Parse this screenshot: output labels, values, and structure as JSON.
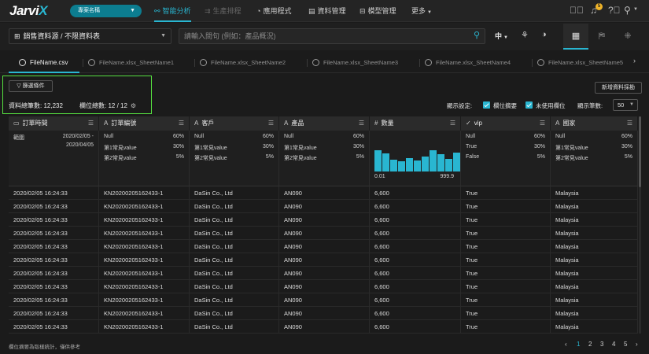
{
  "app": {
    "logo_main": "Jarvi",
    "logo_accent": "X",
    "project": "專案名稱",
    "nav": [
      {
        "label": "智能分析",
        "icon": "analysis-icon",
        "state": "active"
      },
      {
        "label": "生產排程",
        "icon": "schedule-icon",
        "state": "disabled"
      },
      {
        "label": "應用程式",
        "icon": "apps-icon",
        "state": "normal"
      },
      {
        "label": "資料管理",
        "icon": "data-icon",
        "state": "normal"
      },
      {
        "label": "模型管理",
        "icon": "model-icon",
        "state": "normal"
      },
      {
        "label": "更多",
        "icon": "chevron-down-icon",
        "state": "normal"
      }
    ],
    "notification_count": "5"
  },
  "toolbar": {
    "datasource": "銷售資料源 / 不限資料表",
    "query_placeholder": "請輸入問句 (例如：產品概況)",
    "language": "中"
  },
  "file_tabs": [
    {
      "label": "FileName.csv",
      "active": true
    },
    {
      "label": "FileName.xlsx_SheetName1",
      "active": false
    },
    {
      "label": "FileName.xlsx_SheetName2",
      "active": false
    },
    {
      "label": "FileName.xlsx_SheetName3",
      "active": false
    },
    {
      "label": "FileName.xlsx_SheetName4",
      "active": false
    },
    {
      "label": "FileName.xlsx_SheetName5",
      "active": false
    }
  ],
  "controls": {
    "filter_label": "篩選條件",
    "total_records": "資料總筆數: 12,232",
    "total_columns": "欄位總數: 12 / 12",
    "new_mapping": "新增資料採勘",
    "display_settings": "顯示設定:",
    "show_summary": "欄位摘要",
    "show_unused": "未使用欄位",
    "page_size_label": "顯示筆數:",
    "page_size": "50"
  },
  "columns": [
    {
      "type_icon": "▭",
      "name": "訂單時間"
    },
    {
      "type_icon": "A",
      "name": "訂單編號"
    },
    {
      "type_icon": "A",
      "name": "客戶"
    },
    {
      "type_icon": "A",
      "name": "產品"
    },
    {
      "type_icon": "#",
      "name": "數量"
    },
    {
      "type_icon": "✓",
      "name": "vip"
    },
    {
      "type_icon": "A",
      "name": "國家"
    }
  ],
  "summary": {
    "date_label": "範圍",
    "date_from": "2020/02/05 -",
    "date_to": "2020/04/05",
    "text_stats": [
      {
        "label": "Null",
        "pct": "60%"
      },
      {
        "label": "第1常見value",
        "pct": "30%"
      },
      {
        "label": "第2常見value",
        "pct": "5%"
      }
    ],
    "bool_stats": [
      {
        "label": "Null",
        "pct": "60%"
      },
      {
        "label": "True",
        "pct": "30%"
      },
      {
        "label": "False",
        "pct": "5%"
      }
    ],
    "histogram": {
      "min": "0.01",
      "max": "999.9",
      "bins": [
        0.95,
        0.82,
        0.55,
        0.45,
        0.6,
        0.5,
        0.68,
        0.95,
        0.78,
        0.58,
        0.85
      ]
    }
  },
  "rows": [
    [
      "2020/02/05 16:24:33",
      "KN20200205162433-1",
      "DaSin Co., Ltd",
      "AN090",
      "6,600",
      "True",
      "Malaysia"
    ],
    [
      "2020/02/05 16:24:33",
      "KN20200205162433-1",
      "DaSin Co., Ltd",
      "AN090",
      "6,600",
      "True",
      "Malaysia"
    ],
    [
      "2020/02/05 16:24:33",
      "KN20200205162433-1",
      "DaSin Co., Ltd",
      "AN090",
      "6,600",
      "True",
      "Malaysia"
    ],
    [
      "2020/02/05 16:24:33",
      "KN20200205162433-1",
      "DaSin Co., Ltd",
      "AN090",
      "6,600",
      "True",
      "Malaysia"
    ],
    [
      "2020/02/05 16:24:33",
      "KN20200205162433-1",
      "DaSin Co., Ltd",
      "AN090",
      "6,600",
      "True",
      "Malaysia"
    ],
    [
      "2020/02/05 16:24:33",
      "KN20200205162433-1",
      "DaSin Co., Ltd",
      "AN090",
      "6,600",
      "True",
      "Malaysia"
    ],
    [
      "2020/02/05 16:24:33",
      "KN20200205162433-1",
      "DaSin Co., Ltd",
      "AN090",
      "6,600",
      "True",
      "Malaysia"
    ],
    [
      "2020/02/05 16:24:33",
      "KN20200205162433-1",
      "DaSin Co., Ltd",
      "AN090",
      "6,600",
      "True",
      "Malaysia"
    ],
    [
      "2020/02/05 16:24:33",
      "KN20200205162433-1",
      "DaSin Co., Ltd",
      "AN090",
      "6,600",
      "True",
      "Malaysia"
    ],
    [
      "2020/02/05 16:24:33",
      "KN20200205162433-1",
      "DaSin Co., Ltd",
      "AN090",
      "6,600",
      "True",
      "Malaysia"
    ],
    [
      "2020/02/05 16:24:33",
      "KN20200205162433-1",
      "DaSin Co., Ltd",
      "AN090",
      "6,600",
      "True",
      "Malaysia"
    ]
  ],
  "footer": {
    "note": "欄位摘要為取樣統計，僅供參考",
    "pages": [
      "1",
      "2",
      "3",
      "4",
      "5"
    ],
    "current_page": "1"
  },
  "colors": {
    "accent": "#29b6d1",
    "highlight": "#56e040"
  }
}
